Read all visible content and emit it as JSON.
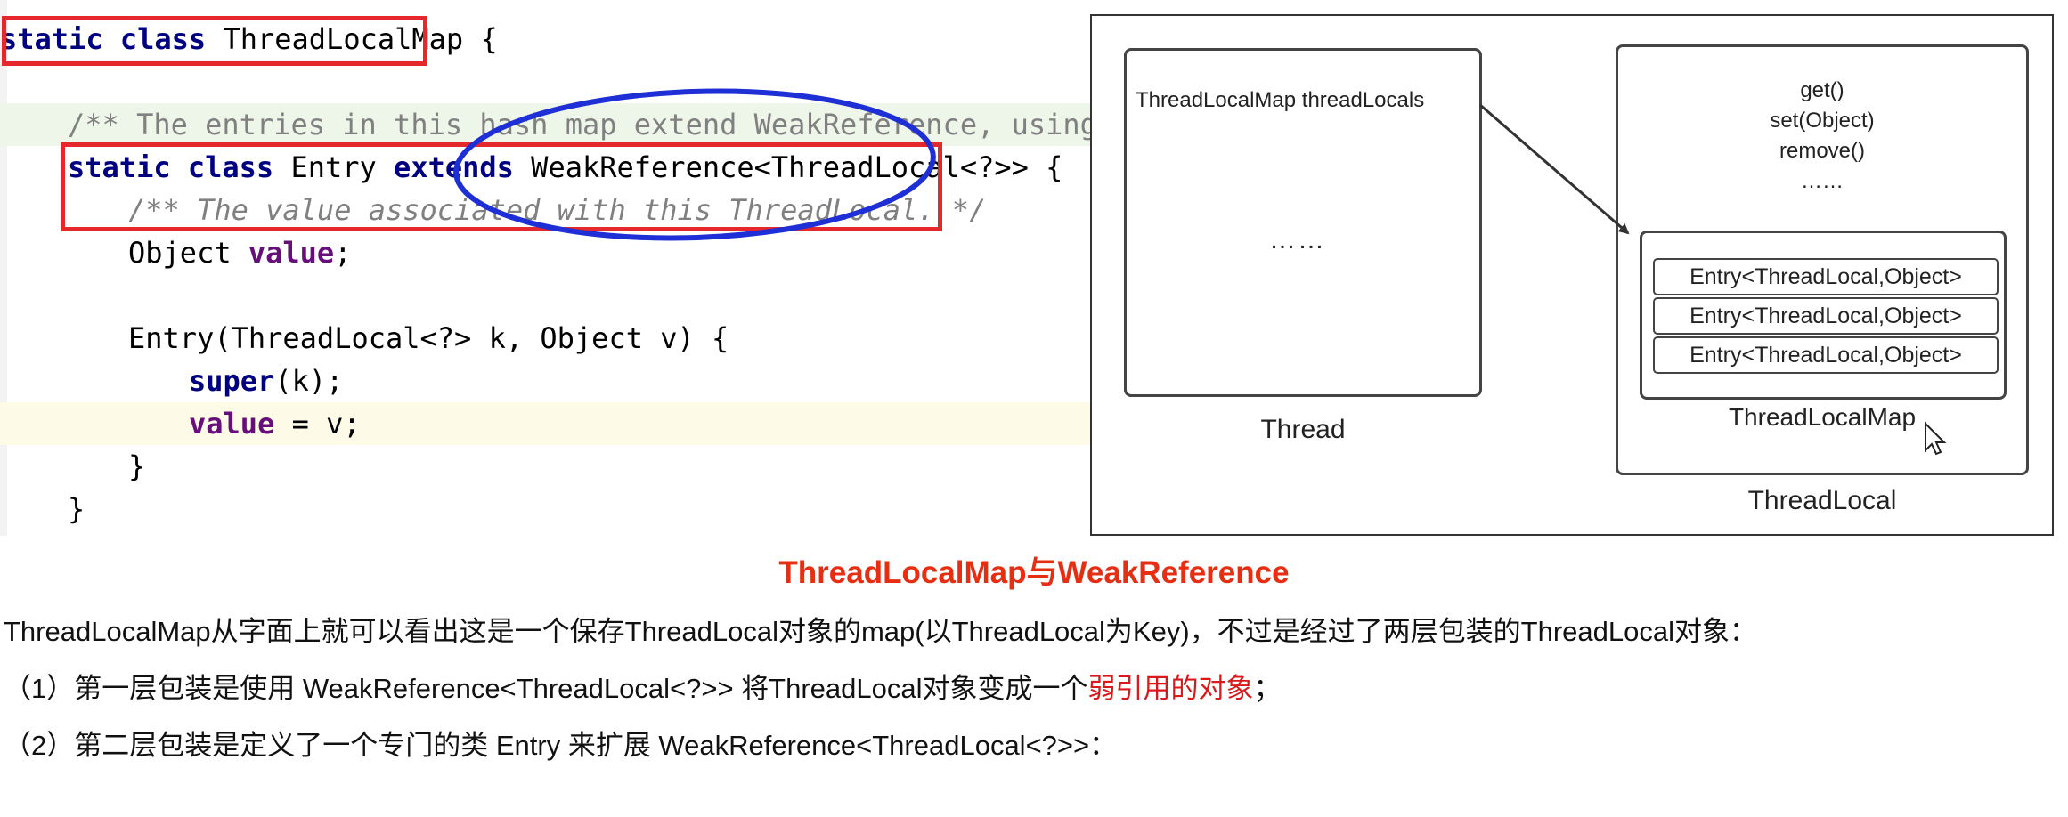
{
  "code": {
    "line1": {
      "kw": "static class",
      "name": " ThreadLocalMap",
      "brace": " {"
    },
    "line2": {
      "comment": "/** The entries in this hash map extend WeakReference, using ...*/"
    },
    "line3": {
      "kw": "static class",
      "name": " Entry ",
      "kw2": "extends",
      "type": " WeakReference<ThreadLocal<?>>",
      "brace": " {"
    },
    "line4": {
      "comment": "/** The value associated with this ThreadLocal. */"
    },
    "line5": {
      "type": "Object ",
      "field": "value",
      "end": ";"
    },
    "line6": {
      "text": "Entry(ThreadLocal<?> k, Object v) {"
    },
    "line7": {
      "kw": "super",
      "args": "(k);"
    },
    "line8": {
      "field": "value",
      "text": " = v;"
    },
    "line9": {
      "text": "}"
    },
    "line10": {
      "text": "}"
    }
  },
  "diagram": {
    "thread_field": "ThreadLocalMap threadLocals",
    "thread_ellipsis": "……",
    "thread_label": "Thread",
    "methods": [
      "get()",
      "set(Object)",
      "remove()",
      "……"
    ],
    "entries": [
      "Entry<ThreadLocal,Object>",
      "Entry<ThreadLocal,Object>",
      "Entry<ThreadLocal,Object>"
    ],
    "map_label": "ThreadLocalMap",
    "threadlocal_label": "ThreadLocal"
  },
  "caption": "ThreadLocalMap与WeakReference",
  "paragraphs": {
    "p1": "ThreadLocalMap从字面上就可以看出这是一个保存ThreadLocal对象的map(以ThreadLocal为Key)，不过是经过了两层包装的ThreadLocal对象：",
    "p2_prefix": "（1）第一层包装是使用 WeakReference<ThreadLocal<?>> 将ThreadLocal对象变成一个",
    "p2_highlight": "弱引用的对象",
    "p2_suffix": "；",
    "p3": "（2）第二层包装是定义了一个专门的类 Entry 来扩展 WeakReference<ThreadLocal<?>>："
  },
  "colors": {
    "annotation_red": "#e5282b",
    "annotation_blue": "#1f2fd6",
    "caption_red": "#e62e12",
    "keyword_navy": "#000080",
    "field_purple": "#660e7a"
  }
}
